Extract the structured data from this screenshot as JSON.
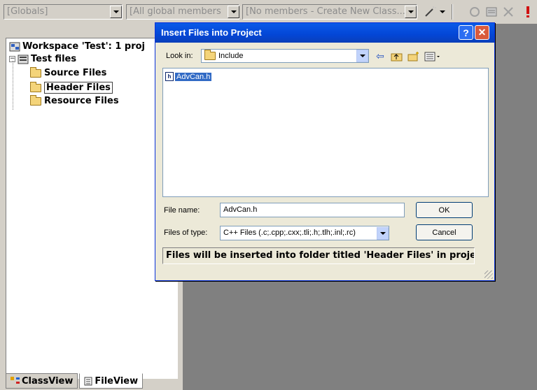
{
  "toolbar": {
    "globals_combo": "[Globals]",
    "members_combo": "[All global members",
    "class_combo": "[No members - Create New Class...]"
  },
  "workspace": {
    "title": "Workspace 'Test': 1 proj",
    "project": "Test files",
    "folders": [
      "Source Files",
      "Header Files",
      "Resource Files"
    ],
    "selected_folder": "Header Files",
    "tabs": [
      "ClassView",
      "FileView"
    ],
    "active_tab": "FileView"
  },
  "dialog": {
    "title": "Insert Files into Project",
    "look_in_label": "Look in:",
    "look_in_value": "Include",
    "files": [
      "AdvCan.h"
    ],
    "file_name_label": "File name:",
    "file_name_value": "AdvCan.h",
    "files_of_type_label": "Files of type:",
    "files_of_type_value": "C++ Files (.c;.cpp;.cxx;.tli;.h;.tlh;.inl;.rc)",
    "ok_label": "OK",
    "cancel_label": "Cancel",
    "status_text": "Files will be inserted into folder titled 'Header Files' in projec",
    "help_glyph": "?",
    "close_glyph": "✕"
  },
  "colors": {
    "titlebar": "#0346d6",
    "selection": "#316ac5",
    "chrome": "#d4d0c8",
    "mdi_background": "#808080"
  }
}
